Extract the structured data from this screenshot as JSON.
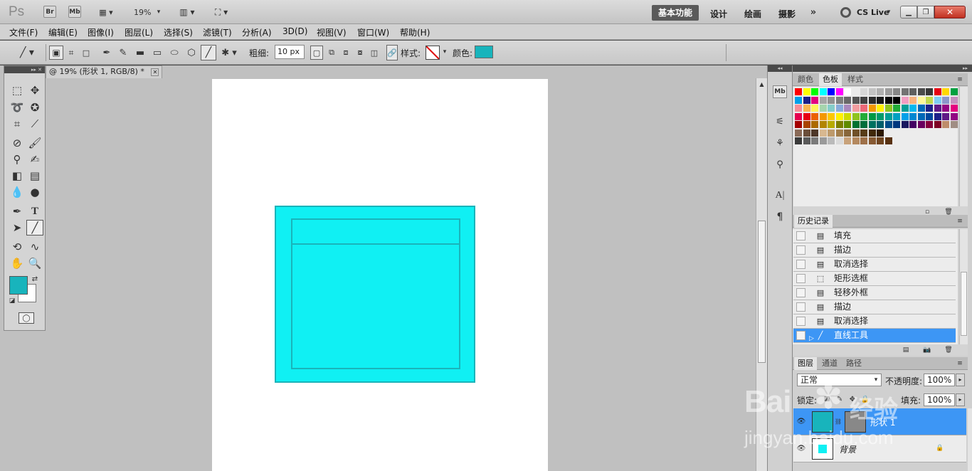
{
  "app": {
    "logo": "Ps",
    "bridge": "Br",
    "minibridge": "Mb",
    "zoom": "19%"
  },
  "workspaces": [
    "基本功能",
    "设计",
    "绘画",
    "摄影"
  ],
  "cslive": "CS Live",
  "menus": [
    "文件(F)",
    "编辑(E)",
    "图像(I)",
    "图层(L)",
    "选择(S)",
    "滤镜(T)",
    "分析(A)",
    "3D(D)",
    "视图(V)",
    "窗口(W)",
    "帮助(H)"
  ],
  "options": {
    "weight_label": "粗细:",
    "weight_value": "10 px",
    "style_label": "样式:",
    "color_label": "颜色:"
  },
  "colors": {
    "accent": "#1ab4ba",
    "shape_fill": "#10f0f3",
    "foreground": "#18b4bc",
    "selection": "#3d96f5"
  },
  "document": {
    "tab_title": "@ 19% (形状 1, RGB/8) *"
  },
  "swatch_panel": {
    "tabs": [
      "颜色",
      "色板",
      "样式"
    ]
  },
  "history": {
    "title": "历史记录",
    "items": [
      {
        "label": "填充",
        "icon": "doc-icon"
      },
      {
        "label": "描边",
        "icon": "doc-icon"
      },
      {
        "label": "取消选择",
        "icon": "doc-icon"
      },
      {
        "label": "矩形选框",
        "icon": "marquee-icon"
      },
      {
        "label": "轻移外框",
        "icon": "doc-icon"
      },
      {
        "label": "描边",
        "icon": "doc-icon"
      },
      {
        "label": "取消选择",
        "icon": "doc-icon"
      },
      {
        "label": "直线工具",
        "icon": "line-icon"
      }
    ]
  },
  "layers_panel": {
    "tabs": [
      "图层",
      "通道",
      "路径"
    ],
    "blend_mode": "正常",
    "opacity_label": "不透明度:",
    "opacity_value": "100%",
    "lock_label": "锁定:",
    "fill_label": "填充:",
    "fill_value": "100%",
    "layers": [
      {
        "name": "形状 1",
        "selected": true
      },
      {
        "name": "背景",
        "selected": false
      }
    ]
  },
  "watermark": {
    "brand": "Bai",
    "brand2": "经验",
    "url": "jingyan.baidu.com"
  }
}
